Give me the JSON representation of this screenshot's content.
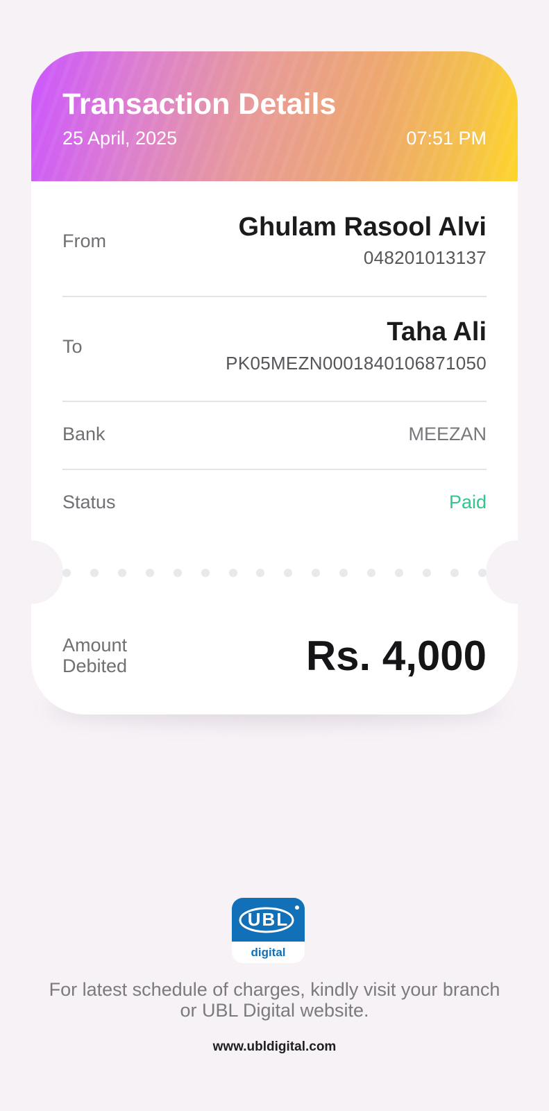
{
  "header": {
    "title": "Transaction Details",
    "date": "25 April, 2025",
    "time": "07:51 PM"
  },
  "from": {
    "label": "From",
    "name": "Ghulam Rasool Alvi",
    "account": "048201013137"
  },
  "to": {
    "label": "To",
    "name": "Taha Ali",
    "account": "PK05MEZN0001840106871050"
  },
  "bank": {
    "label": "Bank",
    "value": "MEEZAN"
  },
  "status": {
    "label": "Status",
    "value": "Paid"
  },
  "amount": {
    "label_line1": "Amount",
    "label_line2": "Debited",
    "value": "Rs. 4,000"
  },
  "footer": {
    "logo_text": "UBL",
    "logo_sub": "digital",
    "note_line1": "For latest schedule of charges, kindly visit your branch",
    "note_line2": "or UBL Digital website.",
    "url": "www.ubldigital.com"
  },
  "colors": {
    "background": "#f6f2f6",
    "paid": "#33c58a",
    "brand_blue": "#1170b8",
    "gradient_start": "#cc55ff",
    "gradient_end": "#ffd52a"
  }
}
